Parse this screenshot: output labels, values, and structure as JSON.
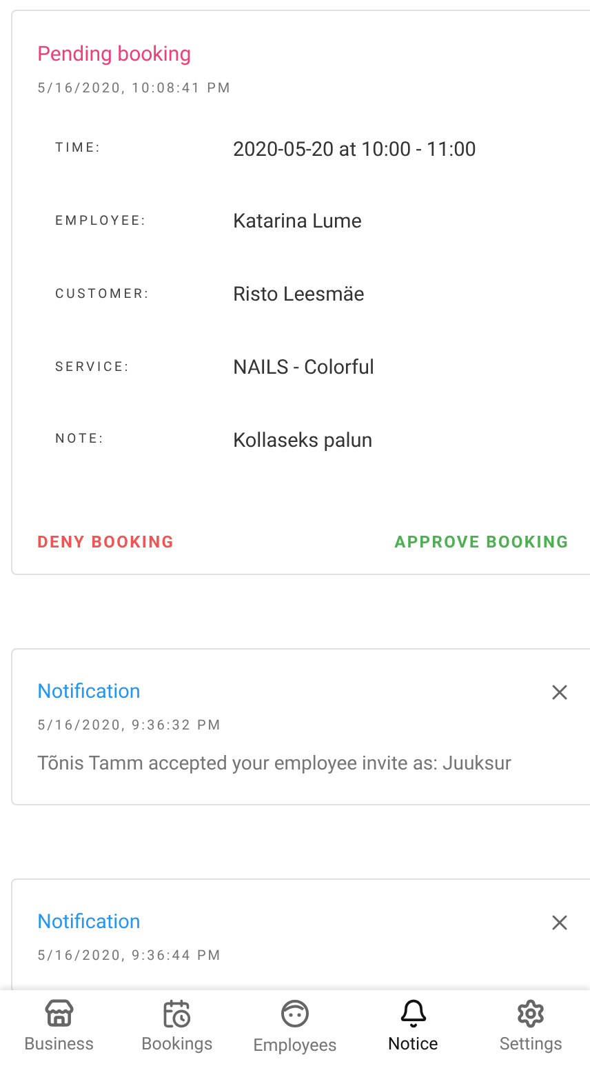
{
  "booking": {
    "title": "Pending booking",
    "timestamp": "5/16/2020, 10:08:41 PM",
    "fields": [
      {
        "label": "TIME:",
        "value": "2020-05-20 at 10:00 - 11:00"
      },
      {
        "label": "EMPLOYEE:",
        "value": "Katarina Lume"
      },
      {
        "label": "CUSTOMER:",
        "value": "Risto Leesmäe"
      },
      {
        "label": "SERVICE:",
        "value": "NAILS - Colorful"
      },
      {
        "label": "NOTE:",
        "value": "Kollaseks palun"
      }
    ],
    "deny": "DENY BOOKING",
    "approve": "APPROVE BOOKING"
  },
  "notifications": [
    {
      "title": "Notification",
      "timestamp": "5/16/2020, 9:36:32 PM",
      "message": "Tõnis Tamm accepted your employee invite as: Juuksur"
    },
    {
      "title": "Notification",
      "timestamp": "5/16/2020, 9:36:44 PM"
    }
  ],
  "nav": [
    {
      "label": "Business",
      "selected": false
    },
    {
      "label": "Bookings",
      "selected": false
    },
    {
      "label": "Employees",
      "selected": false
    },
    {
      "label": "Notice",
      "selected": true
    },
    {
      "label": "Settings",
      "selected": false
    }
  ]
}
